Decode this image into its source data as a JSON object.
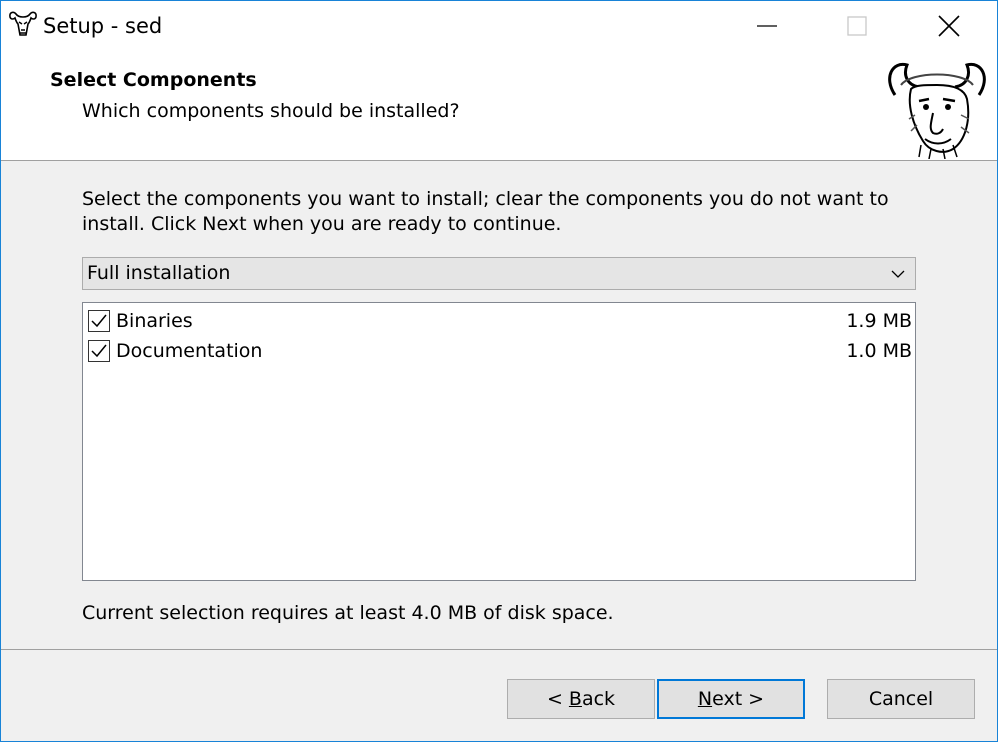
{
  "window": {
    "title": "Setup - sed"
  },
  "header": {
    "title": "Select Components",
    "subtitle": "Which components should be installed?"
  },
  "main": {
    "instructions": "Select the components you want to install; clear the components you do not want to install. Click Next when you are ready to continue.",
    "install_type": {
      "selected": "Full installation"
    },
    "components": [
      {
        "name": "Binaries",
        "size": "1.9 MB",
        "checked": true
      },
      {
        "name": "Documentation",
        "size": "1.0 MB",
        "checked": true
      }
    ],
    "disk_space": "Current selection requires at least 4.0 MB of disk space."
  },
  "buttons": {
    "back": {
      "prefix": "< ",
      "accel": "B",
      "rest": "ack"
    },
    "next": {
      "accel": "N",
      "rest": "ext >"
    },
    "cancel": "Cancel"
  },
  "colors": {
    "accent": "#0078d7",
    "window_border": "#1883d7"
  }
}
